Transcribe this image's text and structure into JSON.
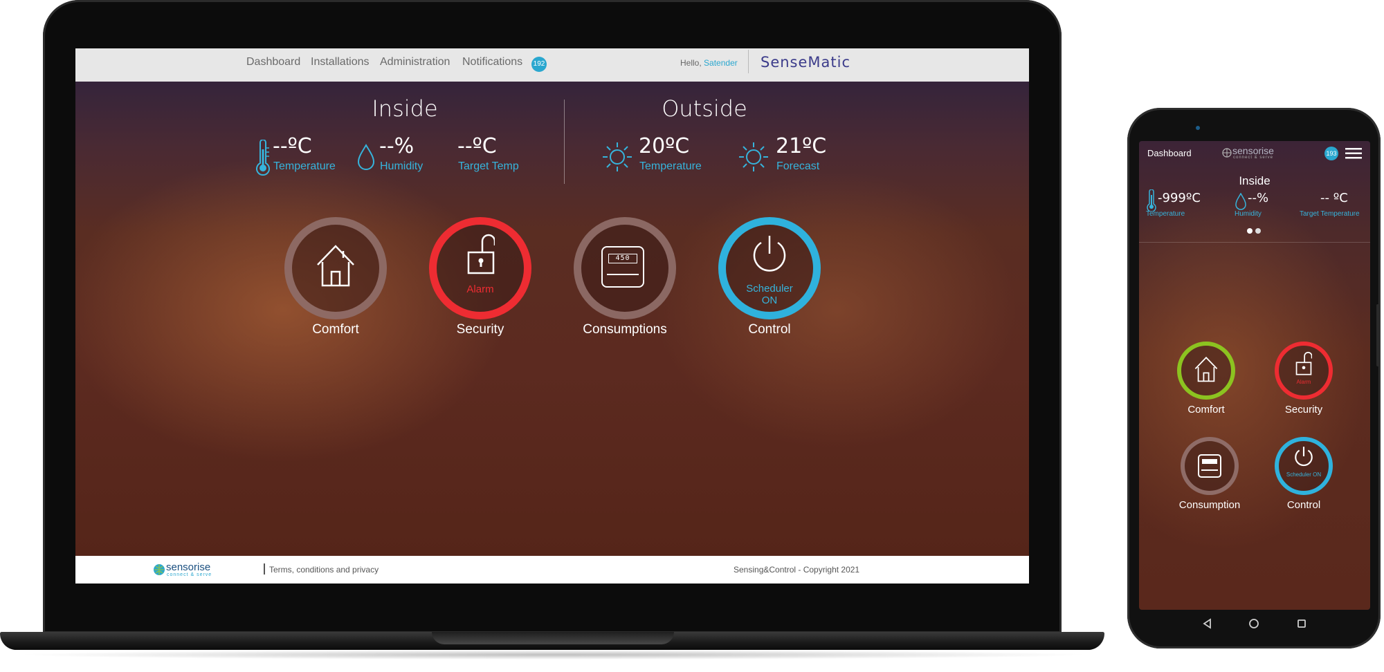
{
  "desktop": {
    "nav": [
      "Dashboard",
      "Installations",
      "Administration",
      "Notifications"
    ],
    "notifications_count": "192",
    "greeting": "Hello,",
    "user": "Satender",
    "brand": "SenseMatic",
    "inside": {
      "title": "Inside",
      "temperature": {
        "value": "--ºC",
        "label": "Temperature"
      },
      "humidity": {
        "value": "--%",
        "label": "Humidity"
      },
      "target": {
        "value": "--ºC",
        "label": "Target Temp"
      }
    },
    "outside": {
      "title": "Outside",
      "temperature": {
        "value": "20ºC",
        "label": "Temperature"
      },
      "forecast": {
        "value": "21ºC",
        "label": "Forecast"
      }
    },
    "tiles": {
      "comfort": "Comfort",
      "security": "Security",
      "security_status": "Alarm",
      "consumptions": "Consumptions",
      "meter": "450",
      "control": "Control",
      "control_status_1": "Scheduler",
      "control_status_2": "ON"
    },
    "footer": {
      "logo": "sensorise",
      "logo_tagline": "connect & serve",
      "terms": "Terms, conditions and privacy",
      "copyright": "Sensing&Control - Copyright 2021"
    }
  },
  "mobile": {
    "title": "Dashboard",
    "logo": "sensorise",
    "logo_tagline": "connect & serve",
    "notifications_count": "193",
    "inside_title": "Inside",
    "temperature": {
      "value": "-999ºC",
      "label": "Temperature"
    },
    "humidity": {
      "value": "--%",
      "label": "Humidity"
    },
    "target": {
      "value": "-- ºC",
      "label": "Target Temperature"
    },
    "tiles": {
      "comfort": "Comfort",
      "security": "Security",
      "security_status": "Alarm",
      "consumption": "Consumption",
      "control": "Control",
      "control_status": "Scheduler ON"
    }
  },
  "colors": {
    "accent_blue": "#2aa7cf",
    "alarm_red": "#ee2c32",
    "comfort_green": "#8cc320",
    "ring_neutral": "#967470"
  },
  "icons": [
    "thermometer-icon",
    "droplet-icon",
    "sun-icon",
    "home-icon",
    "lock-open-icon",
    "meter-icon",
    "power-icon",
    "menu-icon",
    "back-icon",
    "home-circle-icon",
    "recent-apps-icon"
  ]
}
